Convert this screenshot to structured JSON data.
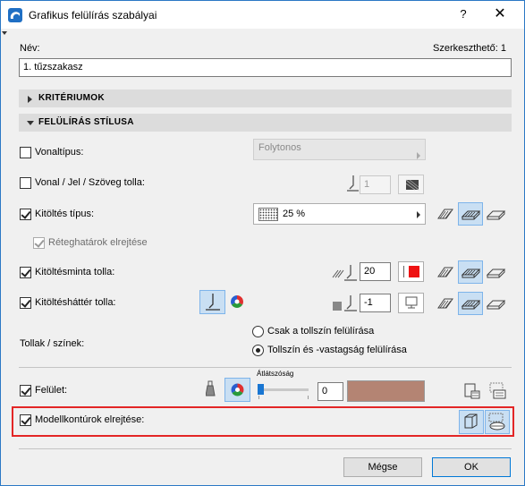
{
  "window": {
    "title": "Grafikus felülírás szabályai",
    "help_icon": "?",
    "close_icon": "✕"
  },
  "header": {
    "name_label": "Név:",
    "editable_label": "Szerkeszthető: 1",
    "name_value": "1. tűzszakasz"
  },
  "sections": {
    "criteria": "KRITÉRIUMOK",
    "style": "FELÜLÍRÁS STÍLUSA"
  },
  "rows": {
    "linetype": {
      "label": "Vonaltípus:",
      "checked": false,
      "dropdown": "Folytonos"
    },
    "line_pen": {
      "label": "Vonal / Jel / Szöveg tolla:",
      "checked": false,
      "pen_value": "1"
    },
    "fill_type": {
      "label": "Kitöltés típus:",
      "checked": true,
      "dropdown": "25 %"
    },
    "hide_layer_borders": {
      "label": "Réteghatárok elrejtése",
      "checked": true
    },
    "fill_pen": {
      "label": "Kitöltésminta tolla:",
      "checked": true,
      "pen_value": "20"
    },
    "fill_bg_pen": {
      "label": "Kitöltésháttér tolla:",
      "checked": true,
      "pen_value": "-1"
    }
  },
  "pens_colors": {
    "label": "Tollak / színek:",
    "options": [
      "Csak a tollszín felülírása",
      "Tollszín és -vastagság felülírása"
    ],
    "selected_index": 1
  },
  "surface": {
    "label": "Felület:",
    "checked": true,
    "transparency_label": "Átlátszóság",
    "transparency_value": "0",
    "swatch_color": "#b48473"
  },
  "model_contours": {
    "label": "Modellkontúrok elrejtése:",
    "checked": true
  },
  "footer": {
    "cancel": "Mégse",
    "ok": "OK"
  },
  "colors": {
    "accent_border": "#e32626",
    "active_btn_bg": "#c9dff3",
    "pen_red": "#ee1111"
  }
}
